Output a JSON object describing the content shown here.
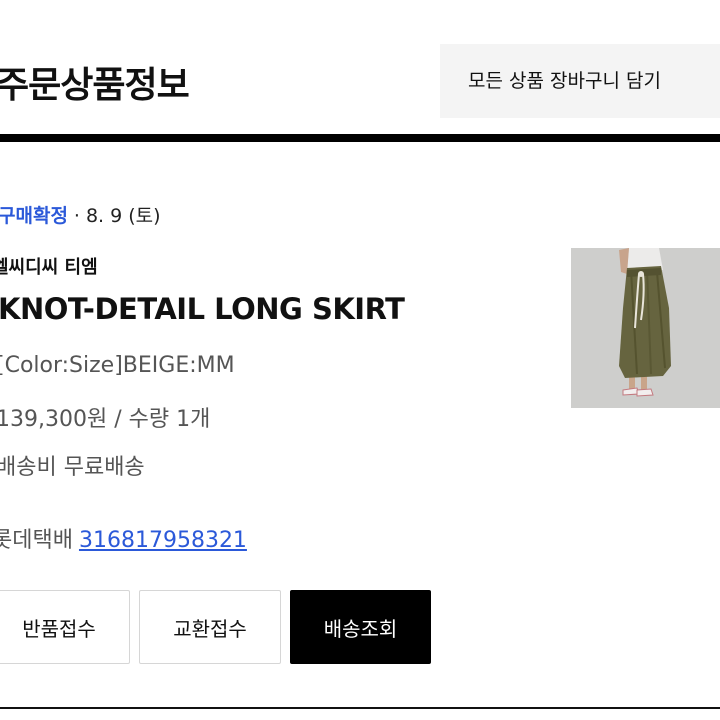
{
  "header": {
    "title": "주문상품정보",
    "add_all_to_cart_label": "모든 상품 장바구니 담기"
  },
  "order": {
    "status": "구매확정",
    "separator": "·",
    "date": "8. 9 (토)",
    "brand": "엘씨디씨 티엠",
    "product_name": "KNOT-DETAIL LONG SKIRT",
    "option": "[Color:Size]BEIGE:MM",
    "price_quantity": "139,300원 / 수량 1개",
    "shipping_fee": "배송비 무료배송",
    "courier": "롯데택배",
    "tracking_number": "316817958321",
    "thumbnail_icon": "product-photo"
  },
  "actions": {
    "return_label": "반품접수",
    "exchange_label": "교환접수",
    "track_label": "배송조회"
  },
  "colors": {
    "status_blue": "#2b59d9",
    "link_blue": "#2b59d9",
    "button_dark": "#000000",
    "button_light_bg": "#f4f4f4"
  }
}
